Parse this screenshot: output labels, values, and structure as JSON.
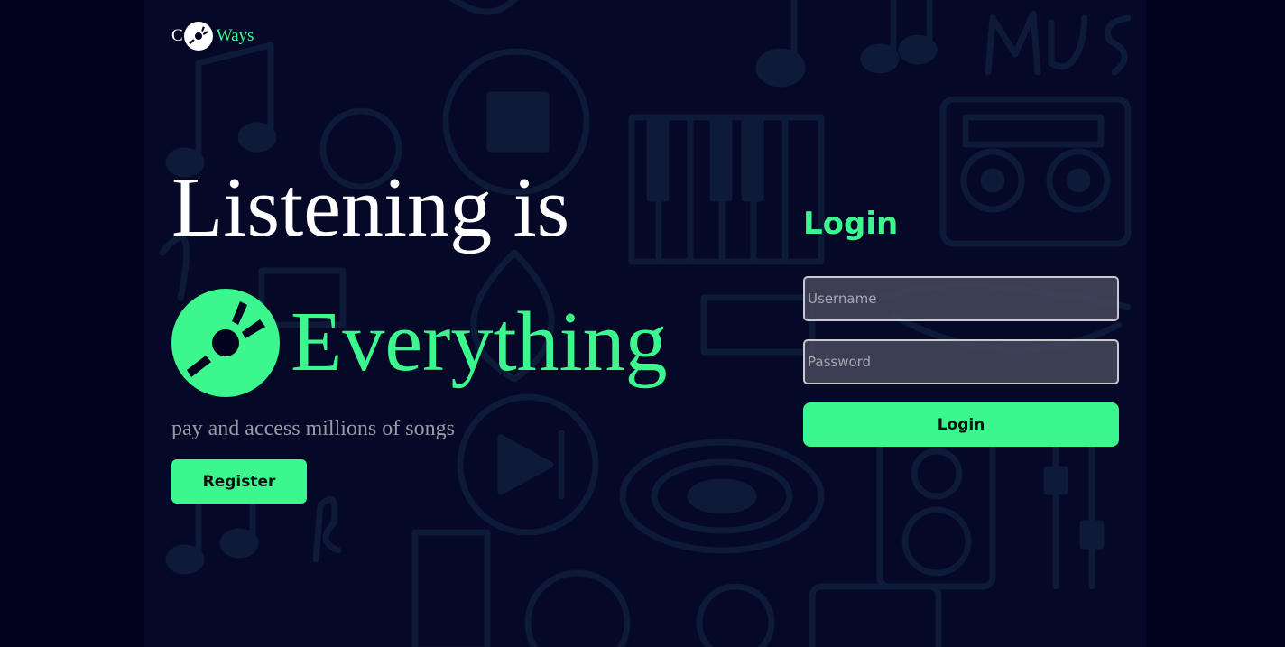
{
  "brand": {
    "prefix": "C",
    "suffix": "Ways",
    "accent_color": "#3bf78e",
    "icon": "vinyl-disc-icon"
  },
  "hero": {
    "line1": "Listening is",
    "line2": "Everything",
    "tagline": "pay and access millions of songs",
    "register_label": "Register",
    "icon": "vinyl-disc-icon"
  },
  "login": {
    "title": "Login",
    "username_placeholder": "Username",
    "password_placeholder": "Password",
    "submit_label": "Login"
  },
  "colors": {
    "background": "#03021d",
    "accent": "#3bf78e",
    "text": "#ffffff",
    "muted_text": "#9a9aa6"
  }
}
